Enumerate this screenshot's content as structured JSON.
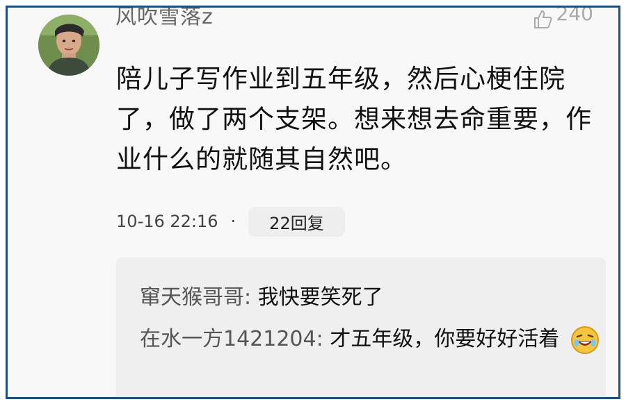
{
  "post": {
    "username": "风吹雪落z",
    "likes": "240",
    "content": "陪儿子写作业到五年级，然后心梗住院了，做了两个支架。想来想去命重要，作业什么的就随其自然吧。",
    "timestamp": "10-16 22:16",
    "separator": "·",
    "reply_label": "22回复"
  },
  "replies": [
    {
      "author": "窜天猴哥哥:",
      "text": "我快要笑死了"
    },
    {
      "author": "在水一方1421204:",
      "text": "才五年级，你要好好活着"
    }
  ],
  "icons": {
    "avatar": "user-avatar",
    "like": "thumbs-up-icon",
    "emoji": "laughing-emoji-icon"
  },
  "colors": {
    "border": "#1f4f7a",
    "reply_bg": "#efefef"
  }
}
